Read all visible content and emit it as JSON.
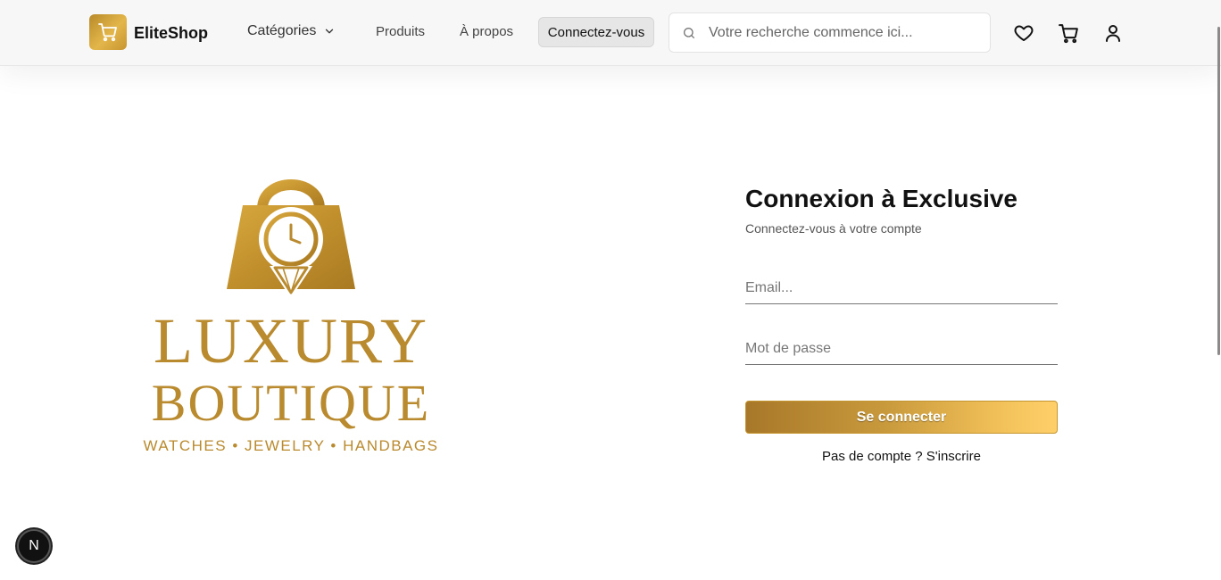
{
  "header": {
    "brand": "EliteShop",
    "logo_icon": "cart-icon",
    "nav": {
      "categories": "Catégories",
      "products": "Produits",
      "about": "À propos",
      "connect": "Connectez-vous"
    },
    "search": {
      "placeholder": "Votre recherche commence ici..."
    },
    "icons": [
      "heart-icon",
      "cart-icon",
      "user-icon",
      "search-icon",
      "chevron-down-icon"
    ]
  },
  "hero_logo": {
    "line1": "LUXURY",
    "line2": "BOUTIQUE",
    "tagline": "WATCHES • JEWELRY • HANDBAGS",
    "color": "#b98a2e"
  },
  "login": {
    "title": "Connexion à Exclusive",
    "subtitle": "Connectez-vous à votre compte",
    "email_placeholder": "Email...",
    "password_placeholder": "Mot de passe",
    "submit_label": "Se connecter",
    "signup_text": "Pas de compte ? S'inscrire"
  },
  "badge": {
    "label": "N"
  },
  "colors": {
    "gold": "#c89530",
    "gold_light": "#ffd06a",
    "header_bg": "#f7f7f7"
  }
}
